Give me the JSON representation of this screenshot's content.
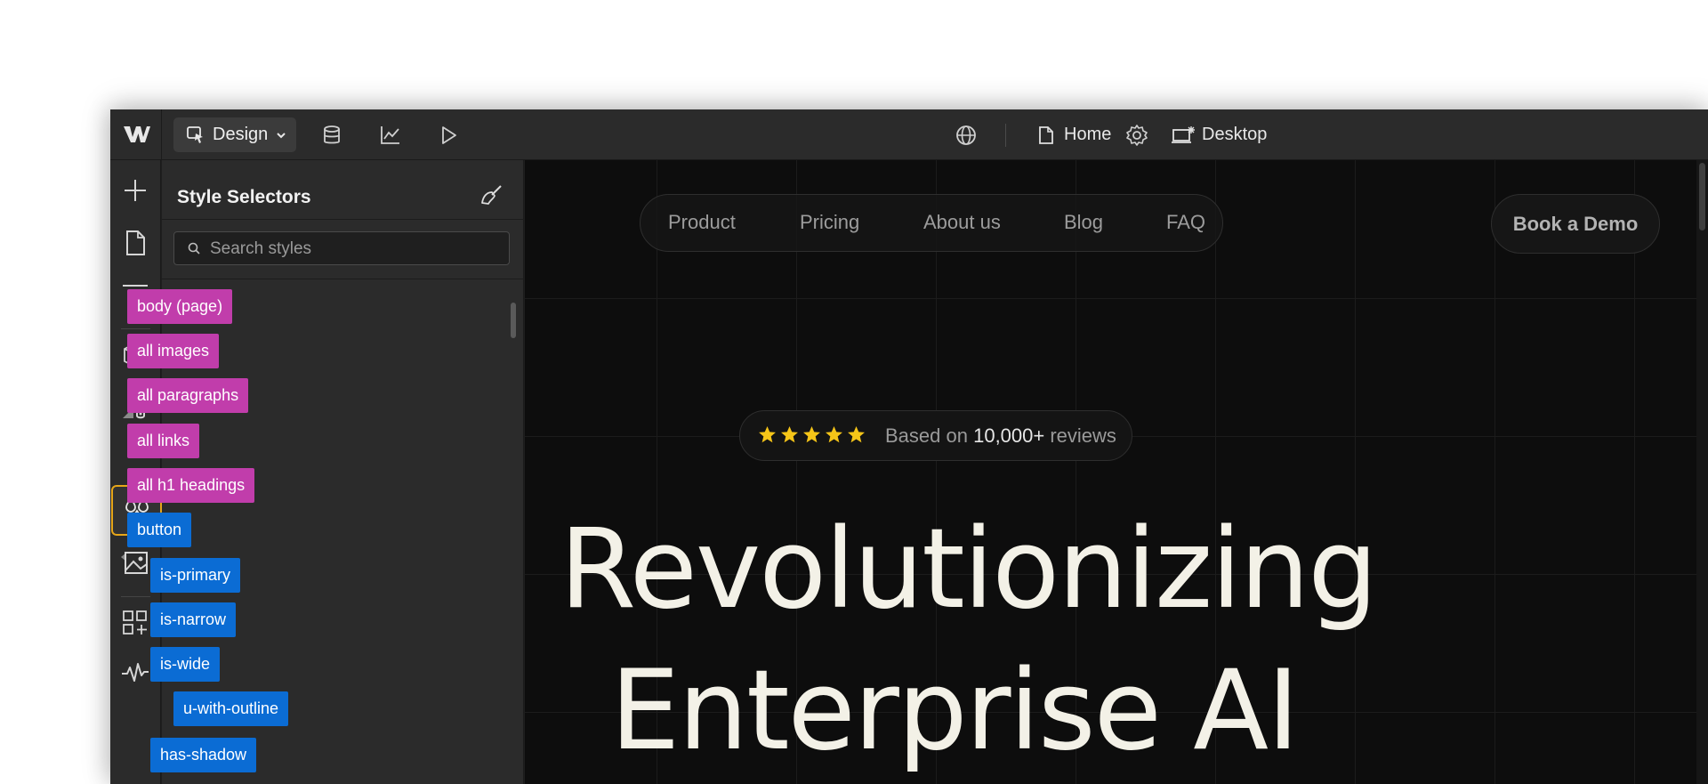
{
  "topbar": {
    "mode_label": "Design",
    "page_label": "Home",
    "breakpoint_label": "Desktop"
  },
  "panel": {
    "title": "Style Selectors",
    "search_placeholder": "Search styles",
    "selectors": [
      {
        "label": "body (page)",
        "kind": "tag",
        "depth": 0
      },
      {
        "label": "all images",
        "kind": "tag",
        "depth": 0
      },
      {
        "label": "all paragraphs",
        "kind": "tag",
        "depth": 0
      },
      {
        "label": "all links",
        "kind": "tag",
        "depth": 0
      },
      {
        "label": "all h1 headings",
        "kind": "tag",
        "depth": 0
      },
      {
        "label": "button",
        "kind": "class",
        "depth": 0
      },
      {
        "label": "is-primary",
        "kind": "class",
        "depth": 1
      },
      {
        "label": "is-narrow",
        "kind": "class",
        "depth": 1
      },
      {
        "label": "is-wide",
        "kind": "class",
        "depth": 1
      },
      {
        "label": "u-with-outline",
        "kind": "class",
        "depth": 2
      },
      {
        "label": "has-shadow",
        "kind": "class",
        "depth": 1
      }
    ]
  },
  "canvas": {
    "nav": [
      "Product",
      "Pricing",
      "About us",
      "Blog",
      "FAQ"
    ],
    "cta_label": "Book a Demo",
    "rating": {
      "stars": 5,
      "prefix": "Based on",
      "count": "10,000+",
      "suffix": "reviews"
    },
    "hero_line1": "Revolutionizing",
    "hero_line2": "Enterprise AI"
  },
  "colors": {
    "accent_active": "#e6a619",
    "tag_pink": "#c13dab",
    "class_blue": "#0b6cd4",
    "star_yellow": "#f5c518",
    "hero_text": "#f3f1e7"
  },
  "icons": {
    "rail": [
      "plus-icon",
      "page-icon",
      "navigator-icon",
      "components-icon",
      "style-manager-icon",
      "style-selectors-icon",
      "assets-icon",
      "apps-icon",
      "activity-icon"
    ],
    "topbar": [
      "webflow-logo",
      "cursor-icon",
      "chevron-down-icon",
      "database-icon",
      "analytics-icon",
      "play-icon",
      "globe-icon",
      "page-icon",
      "gear-icon",
      "desktop-icon"
    ]
  }
}
